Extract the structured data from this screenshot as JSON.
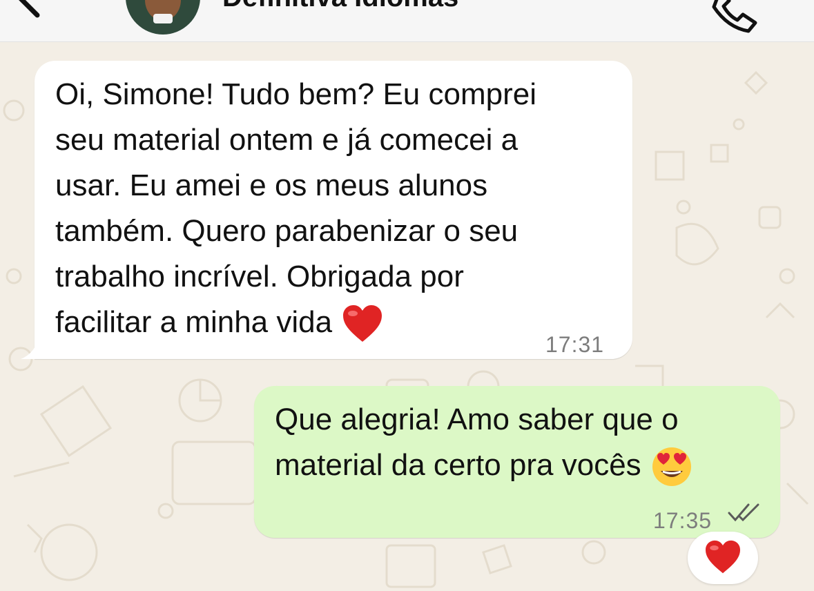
{
  "header": {
    "contact_name": "Definitiva Idiomas"
  },
  "messages": {
    "incoming": {
      "lines": [
        "Oi, Simone! Tudo bem? Eu comprei",
        "seu material ontem e já comecei a",
        "usar. Eu amei e os meus alunos",
        "também. Quero parabenizar o seu",
        "trabalho incrível. Obrigada por",
        "facilitar a minha vida"
      ],
      "time": "17:31"
    },
    "outgoing": {
      "lines": [
        "Que alegria! Amo saber que o",
        "material da certo pra vocês"
      ],
      "time": "17:35",
      "status": "read"
    },
    "reaction": "heart"
  },
  "colors": {
    "incoming_bubble": "#ffffff",
    "outgoing_bubble": "#dcf8c6",
    "read_ticks": "#5a5a5a",
    "heart": "#e02424"
  }
}
